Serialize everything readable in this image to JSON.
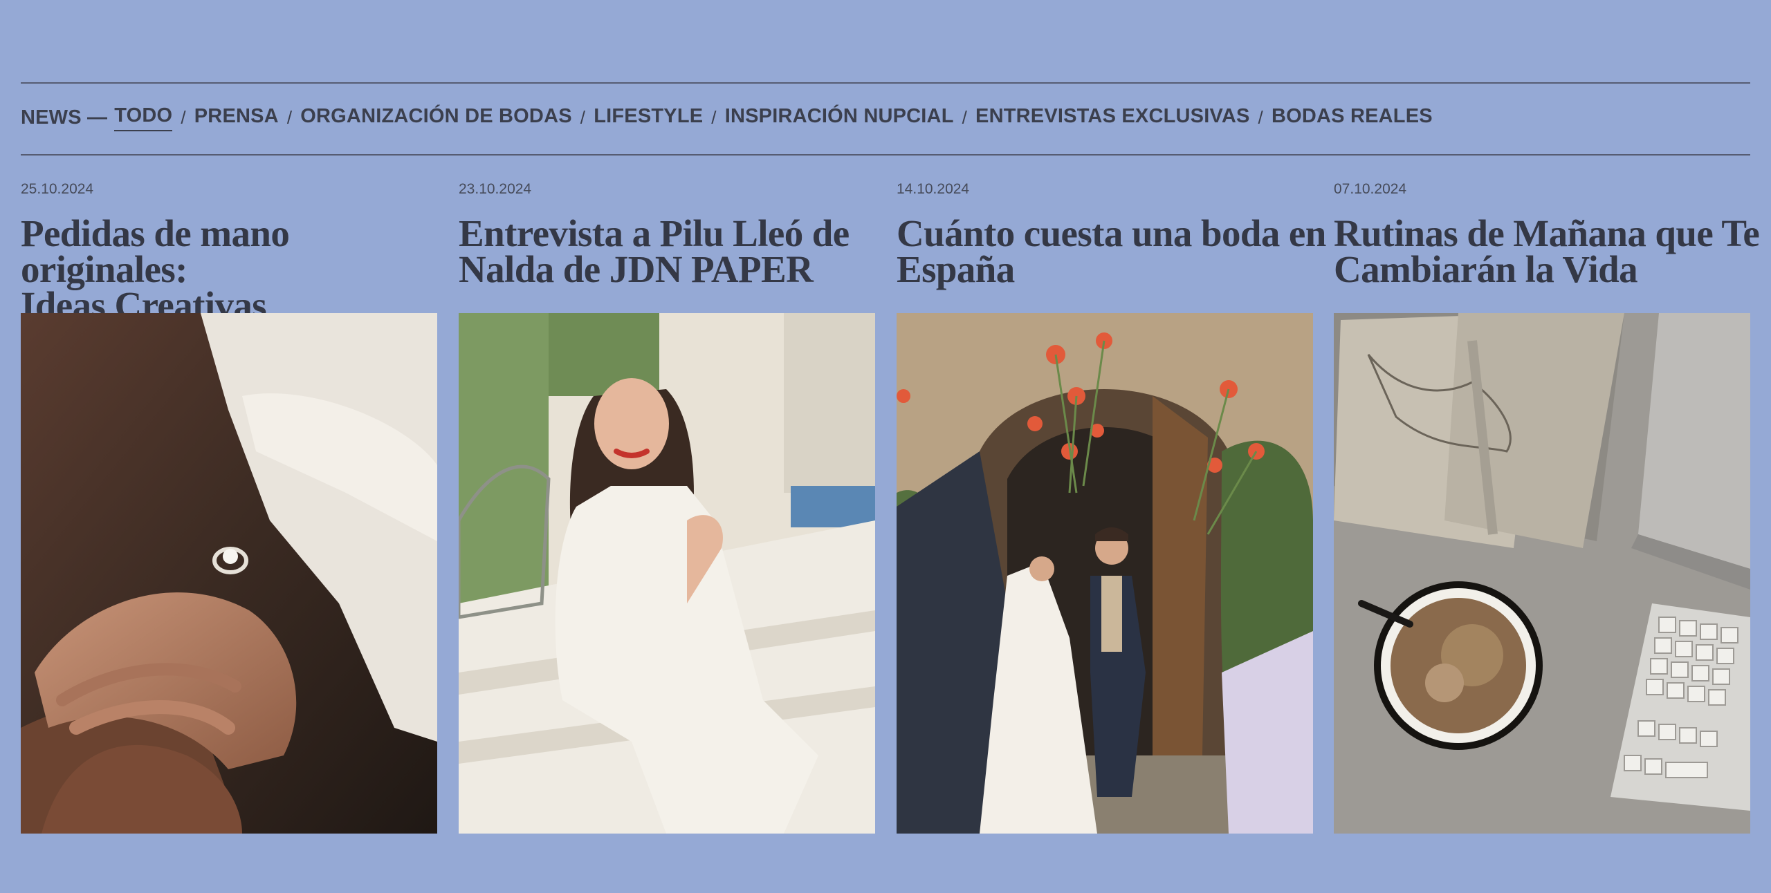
{
  "filters": {
    "lead": "NEWS —",
    "items": [
      {
        "label": "TODO",
        "active": true
      },
      {
        "label": "PRENSA",
        "active": false
      },
      {
        "label": "ORGANIZACIÓN DE BODAS",
        "active": false
      },
      {
        "label": "LIFESTYLE",
        "active": false
      },
      {
        "label": "INSPIRACIÓN NUPCIAL",
        "active": false
      },
      {
        "label": "ENTREVISTAS EXCLUSIVAS",
        "active": false
      },
      {
        "label": "BODAS REALES",
        "active": false
      }
    ],
    "separator": "/"
  },
  "articles": [
    {
      "date": "25.10.2024",
      "title_line1": "Pedidas de mano originales:",
      "title_line2": "Ideas Creativas",
      "image": "engagement-ring-hands-photo"
    },
    {
      "date": "23.10.2024",
      "title_line1": "Entrevista a Pilu Lleó de",
      "title_line2": "Nalda de JDN PAPER",
      "image": "woman-white-suit-on-steps-photo"
    },
    {
      "date": "14.10.2024",
      "title_line1": "Cuánto cuesta una boda en",
      "title_line2": "España",
      "image": "newlyweds-flower-exit-photo"
    },
    {
      "date": "07.10.2024",
      "title_line1": "Rutinas de Mañana que Te",
      "title_line2": "Cambiarán la Vida",
      "image": "coffee-notebook-keyboard-desk-photo"
    }
  ],
  "colors": {
    "background": "#95a9d5",
    "text": "#343846",
    "rule": "#565c72"
  }
}
